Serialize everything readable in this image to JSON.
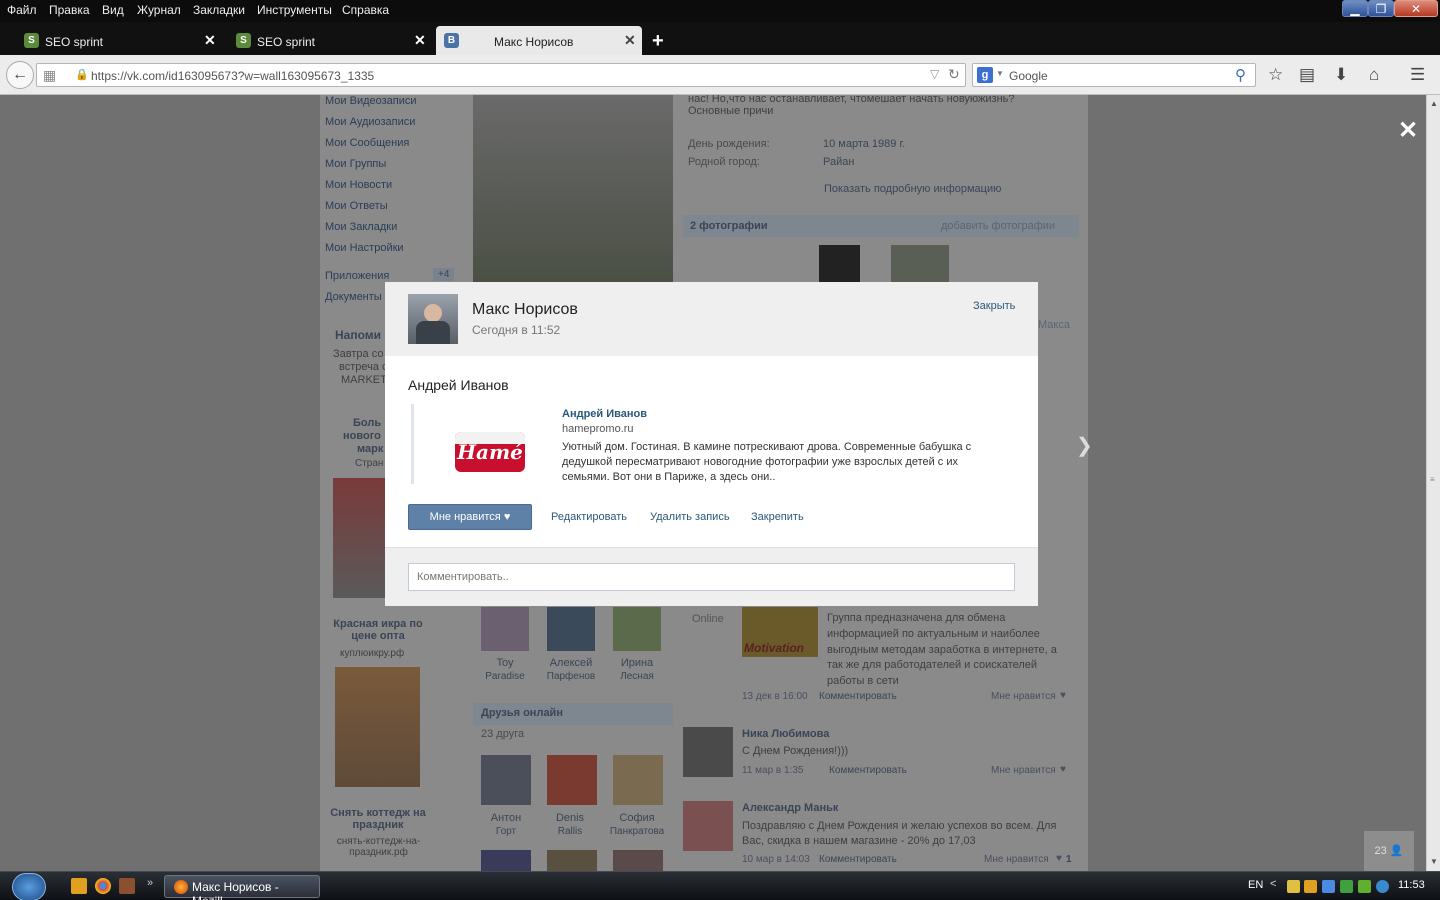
{
  "menu": {
    "items": [
      "Файл",
      "Правка",
      "Вид",
      "Журнал",
      "Закладки",
      "Инструменты",
      "Справка"
    ]
  },
  "tabs": [
    {
      "title": "SEO sprint",
      "favicon": "S",
      "active": false
    },
    {
      "title": "SEO sprint",
      "favicon": "S",
      "active": false
    },
    {
      "title": "Макс Норисов",
      "favicon": "B",
      "active": true
    }
  ],
  "tab_close": "✕",
  "new_tab": "+",
  "nav": {
    "url": "https://vk.com/id163095673?w=wall163095673_1335",
    "search_placeholder": "Google"
  },
  "background": {
    "sidebar": [
      "Мои Видеозаписи",
      "Мои Аудиозаписи",
      "Мои Сообщения",
      "Мои Группы",
      "Мои Новости",
      "Мои Ответы",
      "Мои Закладки",
      "Мои Настройки"
    ],
    "apps": "Приложения",
    "apps_badge": "+4",
    "docs": "Документы",
    "remind_title": "Напоми",
    "remind_lines": [
      "Завтра со",
      "встреча с",
      "MARKETI"
    ],
    "ad1_lines": [
      "Боль",
      "нового",
      "марк",
      "Стран"
    ],
    "ad2_title": "Красная икра по цене опта",
    "ad2_url": "куплюикру.рф",
    "ad3_title": "Снять коттедж на праздник",
    "ad3_url": "снять-коттедж-на-праздник.рф",
    "profile_text": "нас! Но,что нас останавливает, чтомешает начать новуюжизнь? Основные причи",
    "birthday_label": "День рождения:",
    "birthday_value": "10 марта 1989 г.",
    "hometown_label": "Родной город:",
    "hometown_value": "Райан",
    "show_info": "Показать подробную информацию",
    "photos_title": "2 фотографии",
    "add_photos": "добавить фотографии",
    "maksa": "Макса",
    "friends": [
      {
        "first": "Toy",
        "last": "Paradise"
      },
      {
        "first": "Алексей",
        "last": "Парфенов"
      },
      {
        "first": "Ирина",
        "last": "Лесная"
      }
    ],
    "friends_online_title": "Друзья онлайн",
    "friends_online_count": "23 друга",
    "online_friends": [
      {
        "first": "Антон",
        "last": "Горт"
      },
      {
        "first": "Denis",
        "last": "Rallis"
      },
      {
        "first": "София",
        "last": "Панкратова"
      }
    ],
    "online_label": "Online",
    "group_desc": "Группа предназначена для обмена информацией по актуальным и наиболее выгодным методам заработка в интернете, а так же для работодателей и соискателей работы в сети",
    "motivation": "Motivation",
    "post1_meta": "13 дек в 16:00",
    "comment": "Комментировать",
    "like": "Мне нравится",
    "post2_author": "Ника Любимова",
    "post2_text": "С Днем Рождения!)))",
    "post2_meta": "11 мар в 1:35",
    "post3_author": "Александр Маньк",
    "post3_text": "Поздравляю с Днем Рождения и желаю успехов во всем. Для Вас, скидка в нашем магазине - 20% до 17,03",
    "post3_meta": "10 мар в 14:03",
    "post3_likes": "1",
    "online_count": "23"
  },
  "modal": {
    "author": "Макс Норисов",
    "time": "Сегодня в 11:52",
    "close": "Закрыть",
    "post_name": "Андрей Иванов",
    "link": {
      "title": "Андрей Иванов",
      "domain": "hamepromo.ru",
      "description": "Уютный дом. Гостиная. В камине потрескивают дрова. Современные бабушка с дедушкой пересматривают новогодние фотографии уже взрослых детей с их семьями. Вот они в Париже, а здесь они..",
      "logo_text": "Hamé"
    },
    "like_button": "Мне нравится",
    "actions": [
      "Редактировать",
      "Удалить запись",
      "Закрепить"
    ],
    "comment_placeholder": "Комментировать.."
  },
  "taskbar": {
    "app": "Макс Норисов - Mozill...",
    "lang": "EN",
    "time": "11:53"
  }
}
